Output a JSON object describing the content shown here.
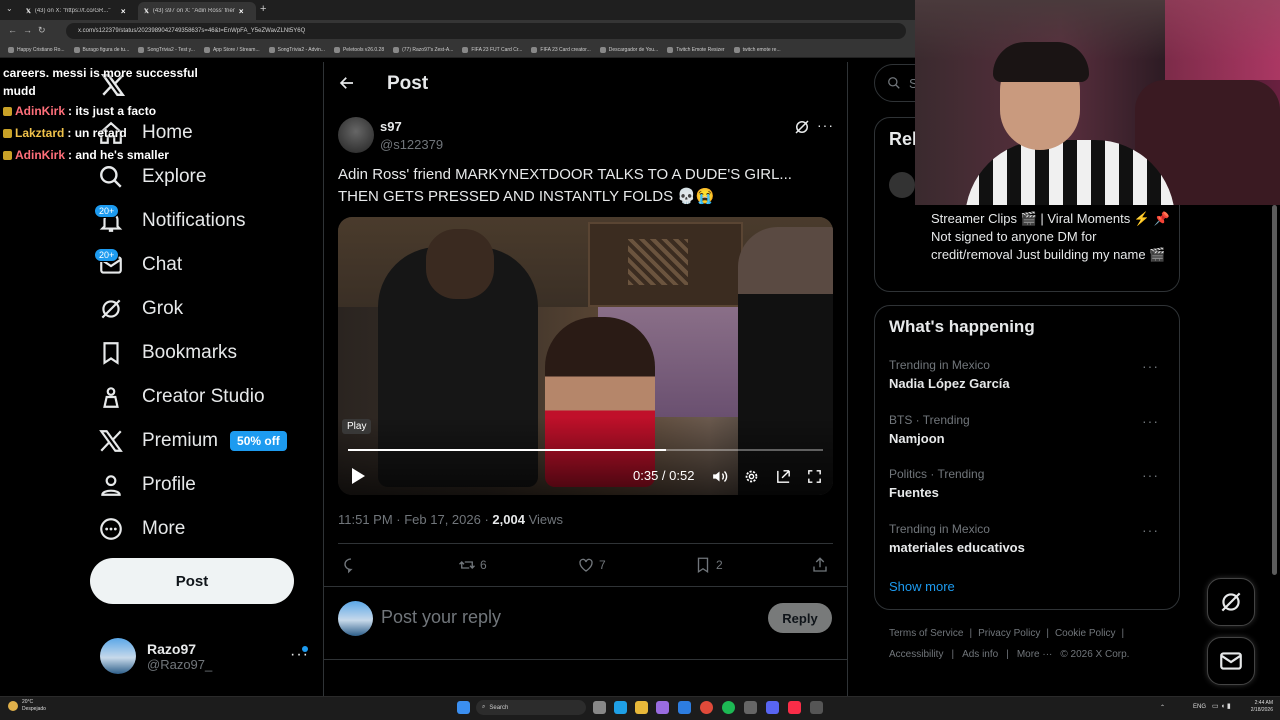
{
  "browser": {
    "tabs": [
      {
        "label": "(43) on X: \"https://t.co/GR...\""
      },
      {
        "label": "(43) s97 on X: \"Adin Ross' frien..."
      }
    ],
    "url": "x.com/s122379/status/2023989042749358637s=46&t=EnWpFA_Y5eZWavZLNt5Y6Q",
    "bookmarks": [
      "Happy Cristiano Ro...",
      "Burago figura de tu...",
      "SongTrivia2 - Test y...",
      "App Store / Stream...",
      "SongTrivia2 - Advin...",
      "Peletools v26.0.28",
      "(77) Razo97's Zest-A...",
      "FIFA 23 FUT Card Cr...",
      "FIFA 23 Card creator...",
      "Descargador de You...",
      "Twitch Emote Resizer",
      "twitch emote re..."
    ]
  },
  "chat": {
    "partial_top": "careers. messi is more successful mudd",
    "messages": [
      {
        "user": "AdinKirk",
        "text": ": its just a facto",
        "color": "#ff6f7a"
      },
      {
        "user": "Lakztard",
        "text": ": un retard",
        "color": "#f0c24b"
      },
      {
        "user": "AdinKirk",
        "text": ": and he's smaller",
        "color": "#ff6f7a"
      }
    ]
  },
  "nav": {
    "items": [
      {
        "label": "Home",
        "icon": "home-icon"
      },
      {
        "label": "Explore",
        "icon": "search-icon"
      },
      {
        "label": "Notifications",
        "icon": "bell-icon",
        "badge": "20+"
      },
      {
        "label": "Chat",
        "icon": "mail-icon",
        "badge": "20+"
      },
      {
        "label": "Grok",
        "icon": "grok-icon"
      },
      {
        "label": "Bookmarks",
        "icon": "bookmark-icon"
      },
      {
        "label": "Creator Studio",
        "icon": "creator-icon"
      },
      {
        "label": "Premium",
        "icon": "x-logo-icon",
        "pill": "50% off"
      },
      {
        "label": "Profile",
        "icon": "person-icon"
      },
      {
        "label": "More",
        "icon": "more-circle-icon"
      }
    ],
    "post_label": "Post",
    "account": {
      "name": "Razo97",
      "handle": "@Razo97_"
    }
  },
  "post": {
    "header": "Post",
    "author": {
      "name": "s97",
      "handle": "@s122379"
    },
    "text": "Adin Ross' friend MARKYNEXTDOOR TALKS TO A DUDE'S GIRL... THEN GETS PRESSED AND INSTANTLY FOLDS 💀😭",
    "video": {
      "tooltip": "Play",
      "time": "0:35 / 0:52",
      "progress": 0.67
    },
    "timestamp": "11:51 PM · Feb 17, 2026 · ",
    "views_count": "2,004",
    "views_label": " Views",
    "actions": {
      "replies": "",
      "reposts": "6",
      "likes": "7",
      "bookmarks": "2"
    },
    "reply_placeholder": "Post your reply",
    "reply_button": "Reply"
  },
  "right": {
    "search_placeholder": "Se",
    "relevant_title_partial": "Rel",
    "bio": "Streamer Clips 🎬 | Viral Moments ⚡ 📌 Not signed to anyone DM for credit/removal Just building my name 🎬",
    "whats_happening": "What's happening",
    "trends": [
      {
        "meta": "Trending in Mexico",
        "name": "Nadia López García"
      },
      {
        "meta": "BTS · Trending",
        "name": "Namjoon"
      },
      {
        "meta": "Politics · Trending",
        "name": "Fuentes"
      },
      {
        "meta": "Trending in Mexico",
        "name": "materiales educativos"
      }
    ],
    "show_more": "Show more",
    "footer": {
      "row1": [
        "Terms of Service",
        "Privacy Policy",
        "Cookie Policy"
      ],
      "row2": [
        "Accessibility",
        "Ads info",
        "More ···",
        "© 2026 X Corp."
      ]
    }
  },
  "taskbar": {
    "weather_temp": "20°C",
    "weather_desc": "Despejado",
    "search": "Search",
    "lang": "ENG",
    "time": "2:44 AM",
    "date": "2/18/2026"
  },
  "colors": {
    "accent": "#1d9bf0",
    "bg": "#000000",
    "border": "#2f3336",
    "muted": "#71767b"
  }
}
